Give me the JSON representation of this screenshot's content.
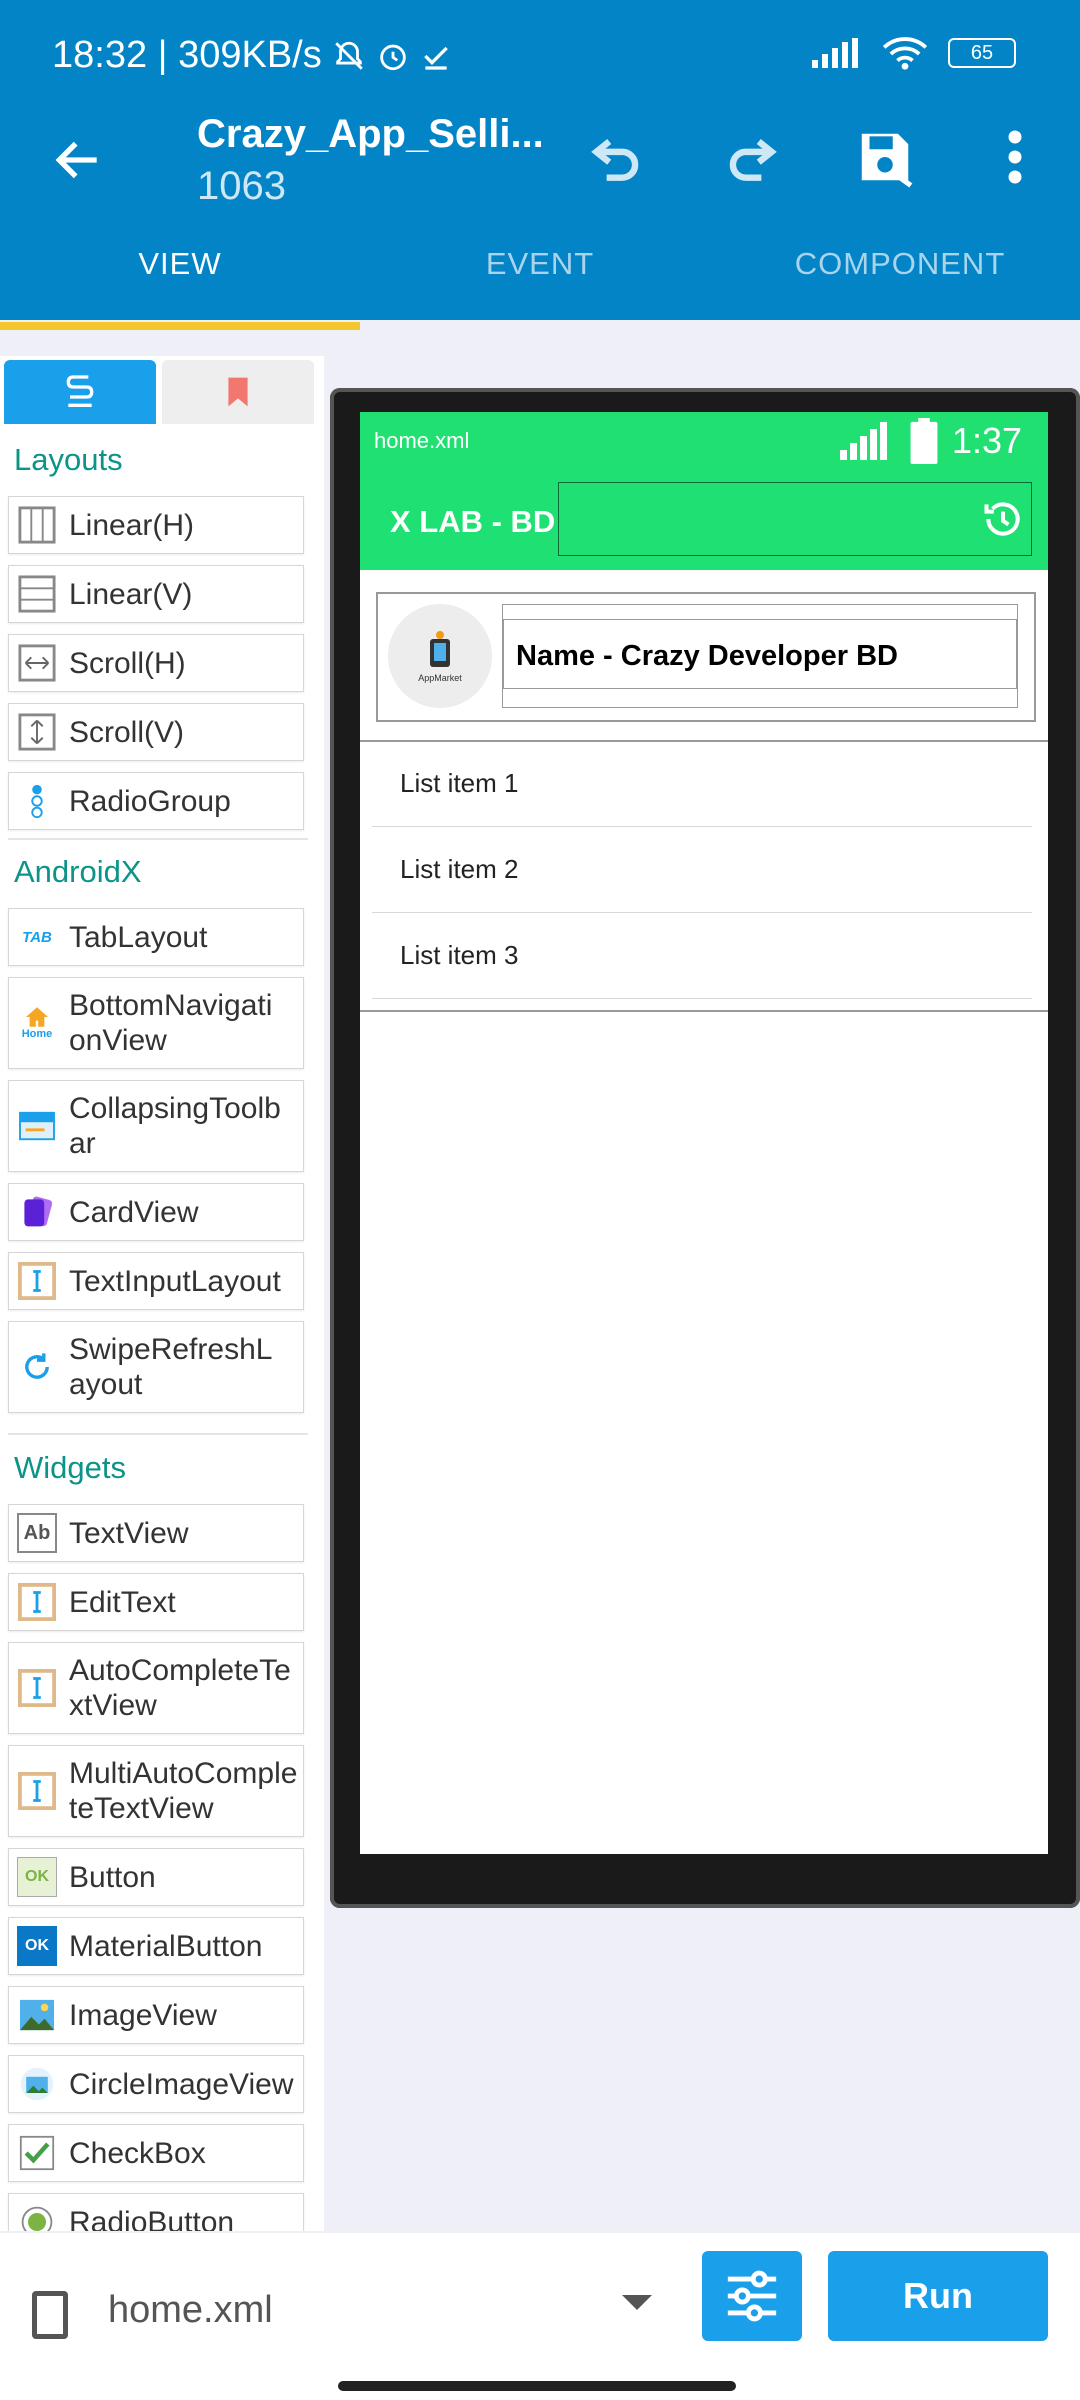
{
  "status_bar": {
    "time_speed": "18:32 | 309KB/s",
    "battery": "65"
  },
  "app_bar": {
    "title": "Crazy_App_Selli...",
    "subtitle": "1063",
    "tabs": [
      "VIEW",
      "EVENT",
      "COMPONENT"
    ]
  },
  "palette": {
    "sections": {
      "layouts": "Layouts",
      "androidx": "AndroidX",
      "widgets": "Widgets"
    },
    "layouts": [
      "Linear(H)",
      "Linear(V)",
      "Scroll(H)",
      "Scroll(V)",
      "RadioGroup"
    ],
    "androidx": [
      "TabLayout",
      "BottomNavigationView",
      "CollapsingToolbar",
      "CardView",
      "TextInputLayout",
      "SwipeRefreshLayout"
    ],
    "widgets": [
      "TextView",
      "EditText",
      "AutoCompleteTextView",
      "MultiAutoCompleteTextView",
      "Button",
      "MaterialButton",
      "ImageView",
      "CircleImageView",
      "CheckBox",
      "RadioButton"
    ],
    "icon_labels": {
      "tab": "TAB",
      "home": "Home",
      "ok": "OK",
      "ab": "Ab"
    }
  },
  "device": {
    "status_file": "home.xml",
    "status_time": "1:37",
    "toolbar_title": "X LAB - BD",
    "logo_text": "AppMarket",
    "card_name": "Name - Crazy Developer BD",
    "list_items": [
      "List item 1",
      "List item 2",
      "List item 3"
    ]
  },
  "bottom_bar": {
    "file_name": "home.xml",
    "run_label": "Run"
  },
  "colors": {
    "primary": "#0284c7",
    "accent_underline": "#f3c62f",
    "device_green": "#21e072",
    "section_teal": "#0c9488",
    "run_button": "#1aa0eb"
  }
}
